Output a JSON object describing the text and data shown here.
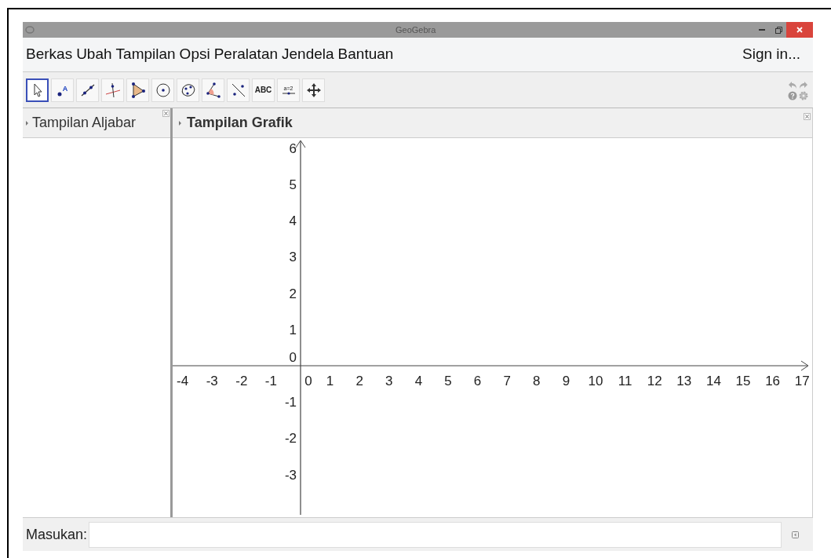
{
  "window": {
    "title": "GeoGebra"
  },
  "menu": [
    "Berkas",
    "Ubah",
    "Tampilan",
    "Opsi",
    "Peralatan",
    "Jendela",
    "Bantuan"
  ],
  "sign_in": "Sign in...",
  "tools": [
    {
      "kind": "move",
      "selected": true
    },
    {
      "kind": "point",
      "label": "A",
      "selected": false
    },
    {
      "kind": "line",
      "selected": false
    },
    {
      "kind": "perpendicular",
      "selected": false
    },
    {
      "kind": "polygon",
      "selected": false
    },
    {
      "kind": "circle",
      "selected": false
    },
    {
      "kind": "conic",
      "selected": false
    },
    {
      "kind": "angle",
      "selected": false
    },
    {
      "kind": "reflect",
      "selected": false
    },
    {
      "kind": "text",
      "label": "ABC",
      "selected": false
    },
    {
      "kind": "slider",
      "label": "a=2",
      "selected": false
    },
    {
      "kind": "pan",
      "selected": false
    }
  ],
  "algebra_view": {
    "title": "Tampilan Aljabar"
  },
  "graphics_view": {
    "title": "Tampilan Grafik",
    "x_ticks": [
      "-4",
      "-3",
      "-2",
      "-1",
      "0",
      "1",
      "2",
      "3",
      "4",
      "5",
      "6",
      "7",
      "8",
      "9",
      "10",
      "11",
      "12",
      "13",
      "14",
      "15",
      "16",
      "17"
    ],
    "y_ticks": [
      "6",
      "5",
      "4",
      "3",
      "2",
      "1",
      "0",
      "-1",
      "-2",
      "-3"
    ]
  },
  "input_bar": {
    "label": "Masukan:"
  }
}
